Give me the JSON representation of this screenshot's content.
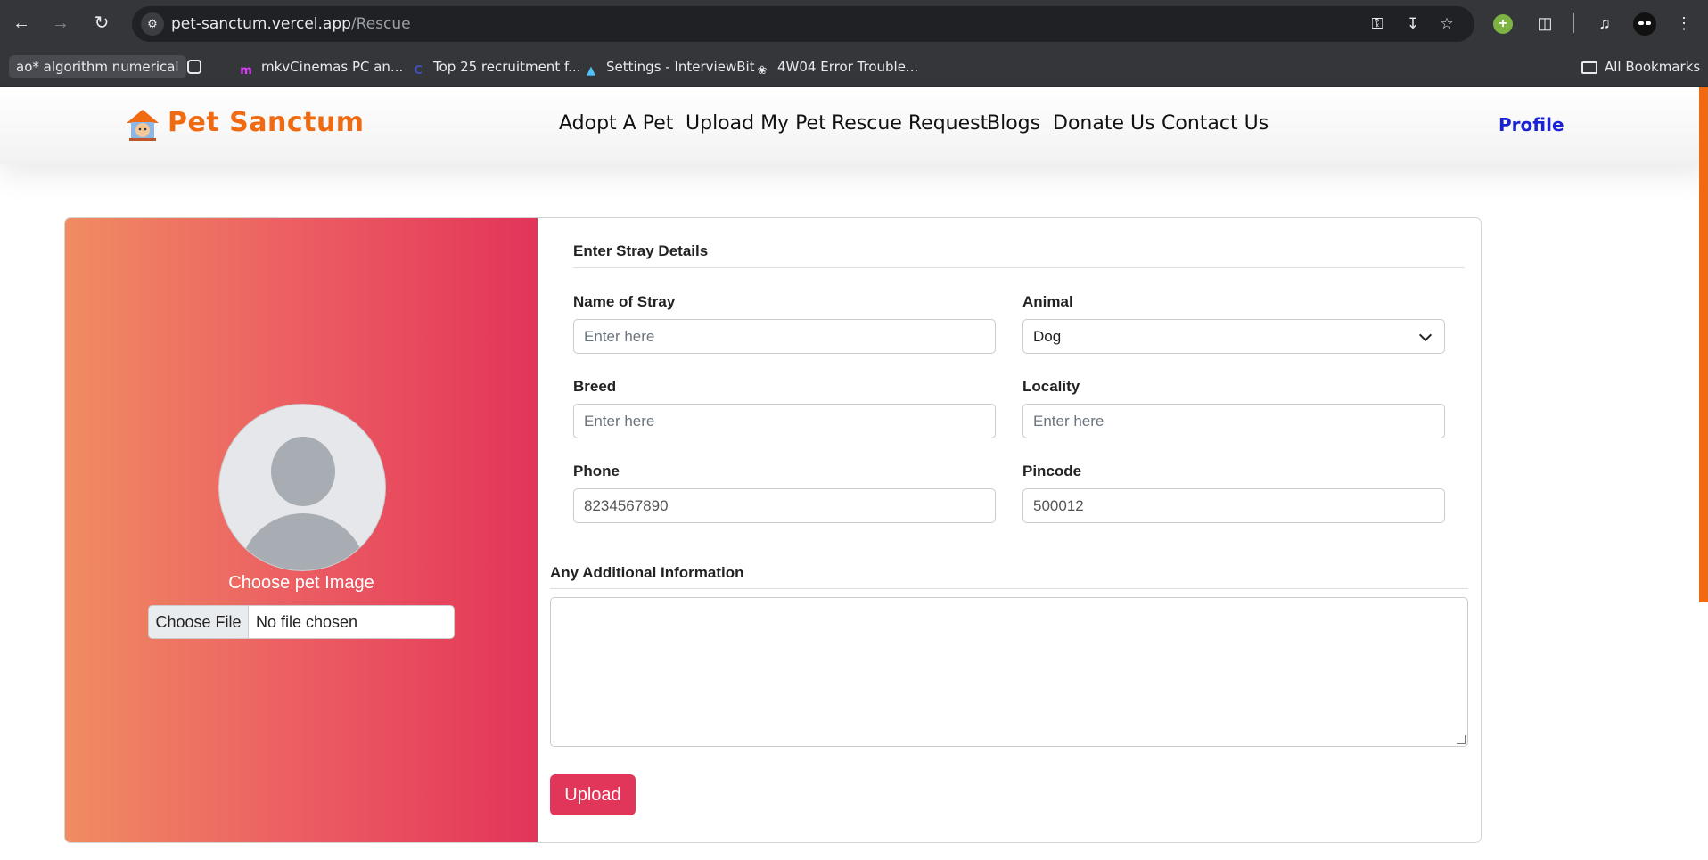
{
  "browser": {
    "url_host": "pet-sanctum.vercel.app",
    "url_path": "/Rescue",
    "bookmarks": [
      {
        "label": "ao* algorithm numerical"
      },
      {
        "label": "mkvCinemas PC an..."
      },
      {
        "label": "Top 25 recruitment f..."
      },
      {
        "label": "Settings - InterviewBit"
      },
      {
        "label": "4W04 Error Trouble..."
      }
    ],
    "all_bookmarks": "All Bookmarks"
  },
  "site": {
    "brand": "Pet Sanctum",
    "brand_color": "#f06a12",
    "nav": [
      "Adopt A Pet",
      "Upload My Pet",
      "Rescue Request",
      "Blogs",
      "Donate Us",
      "Contact Us"
    ],
    "profile": "Profile"
  },
  "form": {
    "image_label": "Choose pet Image",
    "file_button": "Choose File",
    "file_status": "No file chosen",
    "section_title": "Enter Stray Details",
    "name_label": "Name of Stray",
    "name_placeholder": "Enter here",
    "animal_label": "Animal",
    "animal_value": "Dog",
    "breed_label": "Breed",
    "breed_placeholder": "Enter here",
    "locality_label": "Locality",
    "locality_placeholder": "Enter here",
    "phone_label": "Phone",
    "phone_value": "8234567890",
    "pincode_label": "Pincode",
    "pincode_value": "500012",
    "additional_label": "Any Additional Information",
    "upload_button": "Upload",
    "accent_color": "#e2355a"
  }
}
